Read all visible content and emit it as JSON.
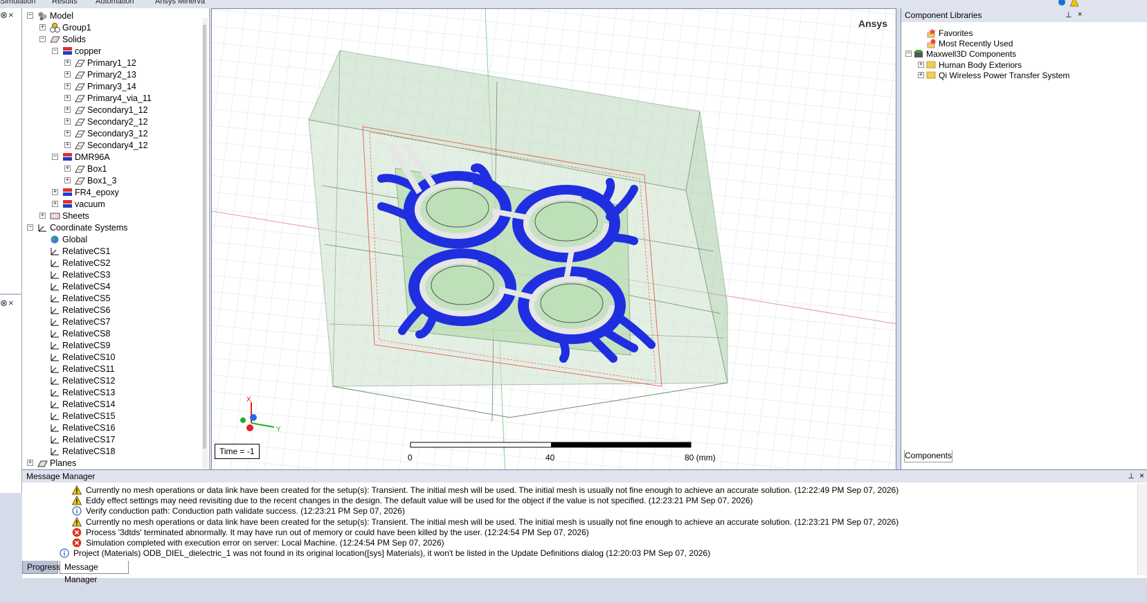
{
  "ribbon": {
    "tabs": [
      "Simulation",
      "Results",
      "Automation",
      "Ansys Minerva"
    ]
  },
  "tree": {
    "items": [
      {
        "label": "Model",
        "level": 0,
        "exp": "-",
        "icon": "model"
      },
      {
        "label": "Group1",
        "level": 1,
        "exp": "+",
        "icon": "group"
      },
      {
        "label": "Solids",
        "level": 1,
        "exp": "-",
        "icon": "solids"
      },
      {
        "label": "copper",
        "level": 2,
        "exp": "-",
        "icon": "material"
      },
      {
        "label": "Primary1_12",
        "level": 3,
        "exp": "+",
        "icon": "solid"
      },
      {
        "label": "Primary2_13",
        "level": 3,
        "exp": "+",
        "icon": "solid"
      },
      {
        "label": "Primary3_14",
        "level": 3,
        "exp": "+",
        "icon": "solid"
      },
      {
        "label": "Primary4_via_11",
        "level": 3,
        "exp": "+",
        "icon": "solid"
      },
      {
        "label": "Secondary1_12",
        "level": 3,
        "exp": "+",
        "icon": "solid"
      },
      {
        "label": "Secondary2_12",
        "level": 3,
        "exp": "+",
        "icon": "solid"
      },
      {
        "label": "Secondary3_12",
        "level": 3,
        "exp": "+",
        "icon": "solid"
      },
      {
        "label": "Secondary4_12",
        "level": 3,
        "exp": "+",
        "icon": "solid"
      },
      {
        "label": "DMR96A",
        "level": 2,
        "exp": "-",
        "icon": "material"
      },
      {
        "label": "Box1",
        "level": 3,
        "exp": "+",
        "icon": "solid"
      },
      {
        "label": "Box1_3",
        "level": 3,
        "exp": "+",
        "icon": "solid"
      },
      {
        "label": "FR4_epoxy",
        "level": 2,
        "exp": "+",
        "icon": "material"
      },
      {
        "label": "vacuum",
        "level": 2,
        "exp": "+",
        "icon": "material"
      },
      {
        "label": "Sheets",
        "level": 1,
        "exp": "+",
        "icon": "sheets"
      },
      {
        "label": "Coordinate Systems",
        "level": 0,
        "exp": "-",
        "icon": "cs"
      },
      {
        "label": "Global",
        "level": 1,
        "exp": "",
        "icon": "global"
      },
      {
        "label": "RelativeCS1",
        "level": 1,
        "exp": "",
        "icon": "cs"
      },
      {
        "label": "RelativeCS2",
        "level": 1,
        "exp": "",
        "icon": "cs"
      },
      {
        "label": "RelativeCS3",
        "level": 1,
        "exp": "",
        "icon": "cs"
      },
      {
        "label": "RelativeCS4",
        "level": 1,
        "exp": "",
        "icon": "cs"
      },
      {
        "label": "RelativeCS5",
        "level": 1,
        "exp": "",
        "icon": "cs"
      },
      {
        "label": "RelativeCS6",
        "level": 1,
        "exp": "",
        "icon": "cs"
      },
      {
        "label": "RelativeCS7",
        "level": 1,
        "exp": "",
        "icon": "cs"
      },
      {
        "label": "RelativeCS8",
        "level": 1,
        "exp": "",
        "icon": "cs"
      },
      {
        "label": "RelativeCS9",
        "level": 1,
        "exp": "",
        "icon": "cs"
      },
      {
        "label": "RelativeCS10",
        "level": 1,
        "exp": "",
        "icon": "cs"
      },
      {
        "label": "RelativeCS11",
        "level": 1,
        "exp": "",
        "icon": "cs"
      },
      {
        "label": "RelativeCS12",
        "level": 1,
        "exp": "",
        "icon": "cs"
      },
      {
        "label": "RelativeCS13",
        "level": 1,
        "exp": "",
        "icon": "cs"
      },
      {
        "label": "RelativeCS14",
        "level": 1,
        "exp": "",
        "icon": "cs"
      },
      {
        "label": "RelativeCS15",
        "level": 1,
        "exp": "",
        "icon": "cs"
      },
      {
        "label": "RelativeCS16",
        "level": 1,
        "exp": "",
        "icon": "cs"
      },
      {
        "label": "RelativeCS17",
        "level": 1,
        "exp": "",
        "icon": "cs"
      },
      {
        "label": "RelativeCS18",
        "level": 1,
        "exp": "",
        "icon": "cs"
      },
      {
        "label": "Planes",
        "level": 0,
        "exp": "+",
        "icon": "planes"
      }
    ]
  },
  "viewport": {
    "brand": "Ansys",
    "time_label": "Time = -1",
    "axis_labels": {
      "x": "X",
      "y": "Y"
    },
    "scale": {
      "ticks": [
        "0",
        "40",
        "80 (mm)"
      ]
    },
    "colors": {
      "air_box": "#cfe3cf",
      "copper": "#1f2fe0",
      "board": "#bde0b8",
      "trace": "#e6e6e6"
    }
  },
  "component_libraries": {
    "title": "Component Libraries",
    "items": [
      {
        "label": "Favorites",
        "exp": "",
        "level": 1,
        "icon": "fav-icon"
      },
      {
        "label": "Most Recently Used",
        "exp": "",
        "level": 1,
        "icon": "recent-icon"
      },
      {
        "label": "Maxwell3D Components",
        "exp": "-",
        "level": 0,
        "icon": "maxwell-icon"
      },
      {
        "label": "Human Body Exteriors",
        "exp": "+",
        "level": 1,
        "icon": "folder-icon"
      },
      {
        "label": "Qi Wireless Power Transfer System",
        "exp": "+",
        "level": 1,
        "icon": "folder-icon"
      }
    ],
    "tab": "Components"
  },
  "messages": {
    "title": "Message Manager",
    "items": [
      {
        "type": "warning",
        "text": "Currently no mesh operations or data link have been created for the setup(s): Transient.  The initial mesh will be used.  The initial mesh is usually not fine enough to achieve an accurate solution. (12:22:49 PM  Sep 07, 2026)"
      },
      {
        "type": "warning",
        "text": "Eddy effect settings may need revisiting due to the recent changes in the design.  The default value will be used for the object if the value is not specified.  (12:23:21 PM  Sep 07, 2026)"
      },
      {
        "type": "info",
        "text": "Verify conduction path: Conduction path validate success. (12:23:21 PM  Sep 07, 2026)"
      },
      {
        "type": "warning",
        "text": "Currently no mesh operations or data link have been created for the setup(s): Transient.  The initial mesh will be used.  The initial mesh is usually not fine enough to achieve an accurate solution. (12:23:21 PM  Sep 07, 2026)"
      },
      {
        "type": "error",
        "text": "Process '3dtds' terminated abnormally.  It may have run out of memory or could have been killed by the user. (12:24:54 PM  Sep 07, 2026)"
      },
      {
        "type": "error",
        "text": "Simulation completed with execution error on server: Local Machine. (12:24:54 PM  Sep 07, 2026)"
      },
      {
        "type": "info",
        "text": "Project (Materials) ODB_DIEL_dielectric_1 was not found in its original location([sys] Materials), it won't be listed in the Update Definitions dialog (12:20:03 PM  Sep 07, 2026)"
      }
    ]
  },
  "bottom_tabs": [
    "Progress",
    "Message Manager"
  ]
}
